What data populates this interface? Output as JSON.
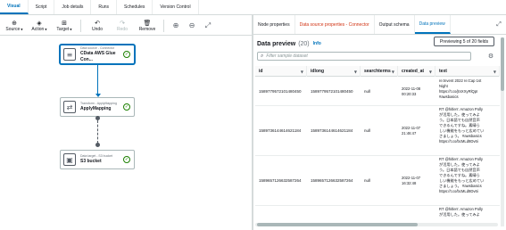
{
  "top_tabs": [
    "Visual",
    "Script",
    "Job details",
    "Runs",
    "Schedules",
    "Version Control"
  ],
  "toolbar": {
    "source": "Source",
    "action": "Action",
    "target": "Target",
    "undo": "Undo",
    "redo": "Redo",
    "remove": "Remove"
  },
  "nodes": [
    {
      "type": "Data source - Connector",
      "name": "CData AWS Glue Con..."
    },
    {
      "type": "Transform - ApplyMapping",
      "name": "ApplyMapping"
    },
    {
      "type": "Data target - S3 bucket",
      "name": "S3 bucket"
    }
  ],
  "right_tabs": [
    "Node properties",
    "Data source properties - Connector",
    "Output schema",
    "Data preview"
  ],
  "preview": {
    "title": "Data preview",
    "count": "(20)",
    "info": "Info",
    "button": "Previewing 5 of 20 fields",
    "filter_placeholder": "Filter sample dataset"
  },
  "table": {
    "columns": [
      "id",
      "idlong",
      "searchterms",
      "created_at",
      "text"
    ],
    "rows": [
      {
        "id": "1589779572101480450",
        "idlong": "1589779572101480450",
        "searchterms": "null",
        "created_at": "2022-11-08\n00:20:33",
        "text": "re:Invent 2022 re:Cap 1st\nNight\nhttps://t.co/jtnXXyRlQpI\n#awsbasics"
      },
      {
        "id": "1589736144614621184",
        "idlong": "1589736144614621184",
        "searchterms": "null",
        "created_at": "2022-11-07\n21:46:47",
        "text": "RT @hitlerr: Amazon Polly\nが活用した。使ってみよ\nう。日本語でも自然音声\nできるんですね。素晴ら\nしい機能をもっと広めてい\nさましょう。 #awsbasics\nhttps://t.co/bcMLd9Dv6i"
      },
      {
        "id": "1589657126632587264",
        "idlong": "1589657126632587264",
        "searchterms": "null",
        "created_at": "2022-11-07\n16:32:48",
        "text": "RT @hitlerr: Amazon Polly\nが活用した。使ってみよ\nう。日本語でも自然音声\nできるんですね。素晴ら\nしい機能をもっと広めてい\nさましょう。 #awsbasics\nhttps://t.co/bcMLd9Dv6i"
      },
      {
        "id": "",
        "idlong": "",
        "searchterms": "",
        "created_at": "",
        "text": "RT @hitlerr: Amazon Polly\nが活用した。使ってみよ"
      }
    ]
  },
  "colors": {
    "accent": "#0073bb",
    "success": "#1d8102",
    "warning": "#d13212"
  }
}
